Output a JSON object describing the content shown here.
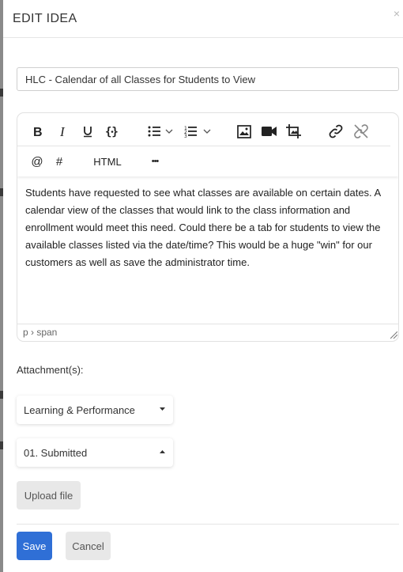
{
  "modal": {
    "title": "EDIT IDEA",
    "close_glyph": "×"
  },
  "idea": {
    "title_value": "HLC - Calendar of all Classes for Students to View",
    "description": "Students have requested to see what classes are available on certain dates. A calendar view of the classes that would link to the class information and enrollment would meet this need. Could there be a tab for students to view the available classes listed via the date/time? This would be a huge \"win\" for our customers as well as save the administrator time."
  },
  "toolbar": {
    "row1": [
      "bold-icon",
      "italic-icon",
      "underline-icon",
      "code-icon",
      "bullet-list-icon",
      "numbered-list-icon",
      "image-icon",
      "video-icon",
      "crop-icon",
      "link-icon",
      "unlink-icon"
    ],
    "mention_label": "@",
    "hashtag_label": "#",
    "html_label": "HTML",
    "more_label": "•••"
  },
  "editor": {
    "element_path": "p › span"
  },
  "attachments": {
    "label": "Attachment(s):"
  },
  "fields": {
    "category_value": "Learning & Performance",
    "status_value": "01. Submitted"
  },
  "actions": {
    "upload_label": "Upload file",
    "save_label": "Save",
    "cancel_label": "Cancel"
  },
  "colors": {
    "primary": "#2f6fd6",
    "button_grey": "#e8e8e8"
  }
}
